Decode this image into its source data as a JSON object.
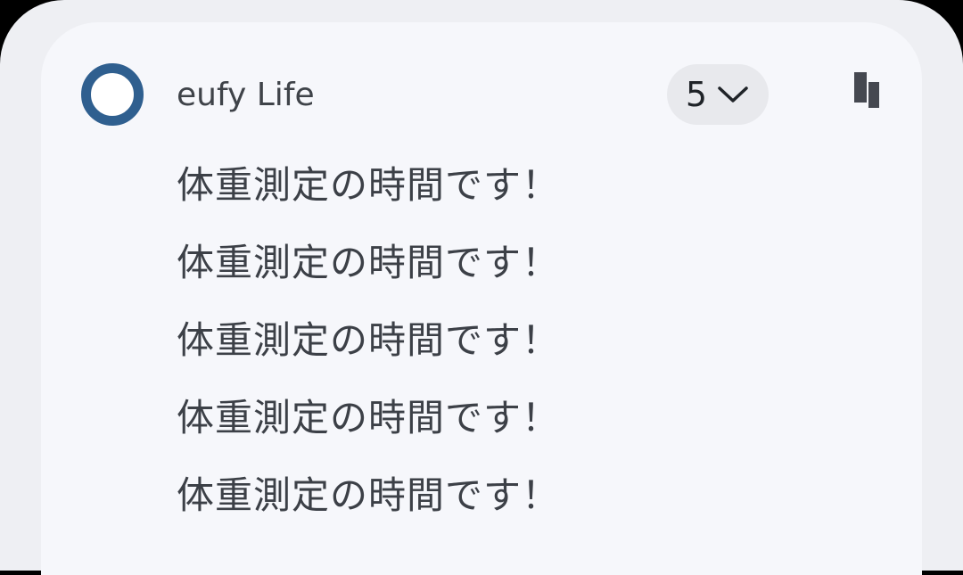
{
  "notification": {
    "app_name": "eufy Life",
    "count": "5",
    "messages": [
      "体重測定の時間です！",
      "体重測定の時間です！",
      "体重測定の時間です！",
      "体重測定の時間です！",
      "体重測定の時間です！"
    ]
  },
  "icons": {
    "app": "app-icon",
    "expand": "chevron-down-icon",
    "copy": "copy-icon"
  },
  "colors": {
    "panel_background": "#eeeff3",
    "card_background": "#f6f7fb",
    "app_icon_ring": "#2f5f8f",
    "text_primary": "#3c4047",
    "chip_background": "#e8e9ed"
  }
}
